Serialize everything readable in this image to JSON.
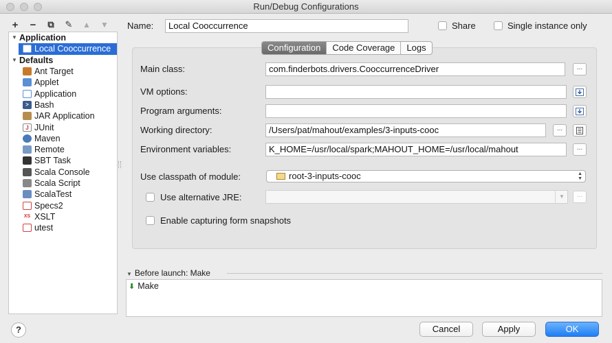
{
  "window": {
    "title": "Run/Debug Configurations"
  },
  "toolbar": {
    "add": "+",
    "remove": "−",
    "copy": "⧉",
    "edit": "✎",
    "move_up": "▲",
    "move_down": "▼"
  },
  "tree": {
    "groups": [
      {
        "label": "Application",
        "items": [
          {
            "label": "Local Cooccurrence",
            "icon": "application-config-icon"
          }
        ]
      },
      {
        "label": "Defaults",
        "items": [
          {
            "label": "Ant Target",
            "icon": "ant-icon"
          },
          {
            "label": "Applet",
            "icon": "applet-icon"
          },
          {
            "label": "Application",
            "icon": "application-icon"
          },
          {
            "label": "Bash",
            "icon": "bash-icon"
          },
          {
            "label": "JAR Application",
            "icon": "jar-icon"
          },
          {
            "label": "JUnit",
            "icon": "junit-icon"
          },
          {
            "label": "Maven",
            "icon": "maven-icon"
          },
          {
            "label": "Remote",
            "icon": "remote-icon"
          },
          {
            "label": "SBT Task",
            "icon": "sbt-icon"
          },
          {
            "label": "Scala Console",
            "icon": "scala-console-icon"
          },
          {
            "label": "Scala Script",
            "icon": "scala-script-icon"
          },
          {
            "label": "ScalaTest",
            "icon": "scalatest-icon"
          },
          {
            "label": "Specs2",
            "icon": "specs2-icon"
          },
          {
            "label": "XSLT",
            "icon": "xslt-icon"
          },
          {
            "label": "utest",
            "icon": "utest-icon"
          }
        ]
      }
    ]
  },
  "header": {
    "name_label": "Name:",
    "name_value": "Local Cooccurrence",
    "share_label": "Share",
    "single_instance_label": "Single instance only"
  },
  "tabs": [
    "Configuration",
    "Code Coverage",
    "Logs"
  ],
  "form": {
    "main_class_label": "Main class:",
    "main_class_value": "com.finderbots.drivers.CooccurrenceDriver",
    "vm_options_label": "VM options:",
    "vm_options_value": "",
    "program_args_label": "Program arguments:",
    "program_args_value": "",
    "working_dir_label": "Working directory:",
    "working_dir_value": "/Users/pat/mahout/examples/3-inputs-cooc",
    "env_vars_label": "Environment variables:",
    "env_vars_value": "K_HOME=/usr/local/spark;MAHOUT_HOME=/usr/local/mahout",
    "classpath_label": "Use classpath of module:",
    "classpath_value": "root-3-inputs-cooc",
    "alt_jre_label": "Use alternative JRE:",
    "alt_jre_value": "",
    "snapshots_label": "Enable capturing form snapshots",
    "ellipsis": "..."
  },
  "before_launch": {
    "label": "Before launch: Make",
    "items": [
      "Make"
    ]
  },
  "footer": {
    "help": "?",
    "cancel": "Cancel",
    "apply": "Apply",
    "ok": "OK"
  },
  "colors": {
    "selection": "#2a6dd6",
    "primary_button": "#1f7ef5"
  }
}
